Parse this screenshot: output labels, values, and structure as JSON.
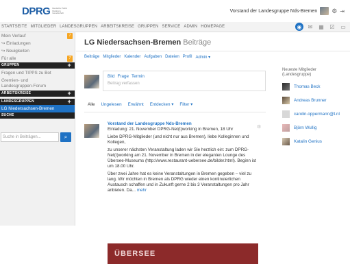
{
  "header": {
    "logo": "DPRG",
    "logo_sub": "Deutsche Public Relations Gesellschaft",
    "user_label": "Vorstand der Landesgruppe Nds-Bremen",
    "gear_icon": "gear-icon",
    "logout_icon": "logout-icon"
  },
  "nav": {
    "items": [
      "STARTSEITE",
      "MITGLIEDER",
      "LANDESGRUPPEN",
      "ARBEITSKREISE",
      "GRUPPEN",
      "SERVICE",
      "ADMIN",
      "HOMEPAGE"
    ],
    "icons": [
      "globe-icon",
      "mail-icon",
      "calendar-icon",
      "check-icon",
      "folder-icon"
    ]
  },
  "sidebar": {
    "items": [
      {
        "label": "Mein Verlauf",
        "badge": "7"
      },
      {
        "label": "↪ Einladungen",
        "badge": ""
      },
      {
        "label": "↪ Neuigkeiten",
        "badge": ""
      },
      {
        "label": "Für alle",
        "badge": "7"
      }
    ],
    "sections": [
      {
        "title": "GRUPPEN"
      },
      {
        "title": "ARBEITSKREISE"
      },
      {
        "title": "LANDESGRUPPEN"
      },
      {
        "title": "SUCHE"
      }
    ],
    "group_items": [
      "Fragen und TIPPS zu Bot",
      "Gremien- und Landesgruppen-Forum"
    ],
    "landesgruppe_selected": "LG Niedersachsen-Bremen",
    "search_placeholder": "Suche in Beiträgen..."
  },
  "main": {
    "title": "LG Niedersachsen-Bremen",
    "title_sub": "Beiträge",
    "links": [
      "Beiträge",
      "Mitglieder",
      "Kalender",
      "Aufgaben",
      "Dateien",
      "Profil",
      "Admin ▾"
    ],
    "composer": {
      "types": [
        "Bild",
        "Frage",
        "Termin"
      ],
      "placeholder": "Beitrag verfassen"
    },
    "filters": [
      "Alle",
      "Ungelesen",
      "Erwähnt",
      "Entdecken ▾",
      "Filter ▾"
    ],
    "post": {
      "author": "Vorstand der Landesgruppe Nds-Bremen",
      "subject": "Einladung: 21. November DPRG-Net(t)working in Bremen, 18 Uhr",
      "p1": "Liebe DPRG-Mitglieder (und nicht nur aus Bremen), liebe Kolleginnen und Kollegen,",
      "p2": "zu unserer nächsten Veranstaltung laden wir Sie herzlich ein: zum DPRG-Net(t)working am 21. November in Bremen in der eleganten Lounge des Übersee-Museums (http://www.restaurant-uebersee.de/bilder.html). Beginn ist um 18.00 Uhr.",
      "p3": "Über zwei Jahre hat es keine Veranstaltungen in Bremen gegeben – viel zu lang. Wir möchten in Bremen als DPRG wieder einen kontinuierlichen Austausch schaffen und in Zukunft gerne 2 bis 3 Veranstaltungen pro Jahr anbieten. Da...",
      "more": "mehr",
      "image_text": "ÜBERSEE"
    }
  },
  "right": {
    "title": "Neueste Mitglieder (Landesgruppe)",
    "members": [
      "Thomas Beck",
      "Andreas Brunner",
      "carolin.oppermann@t.nl",
      "Björn Wullig",
      "Katalin Genius"
    ]
  }
}
